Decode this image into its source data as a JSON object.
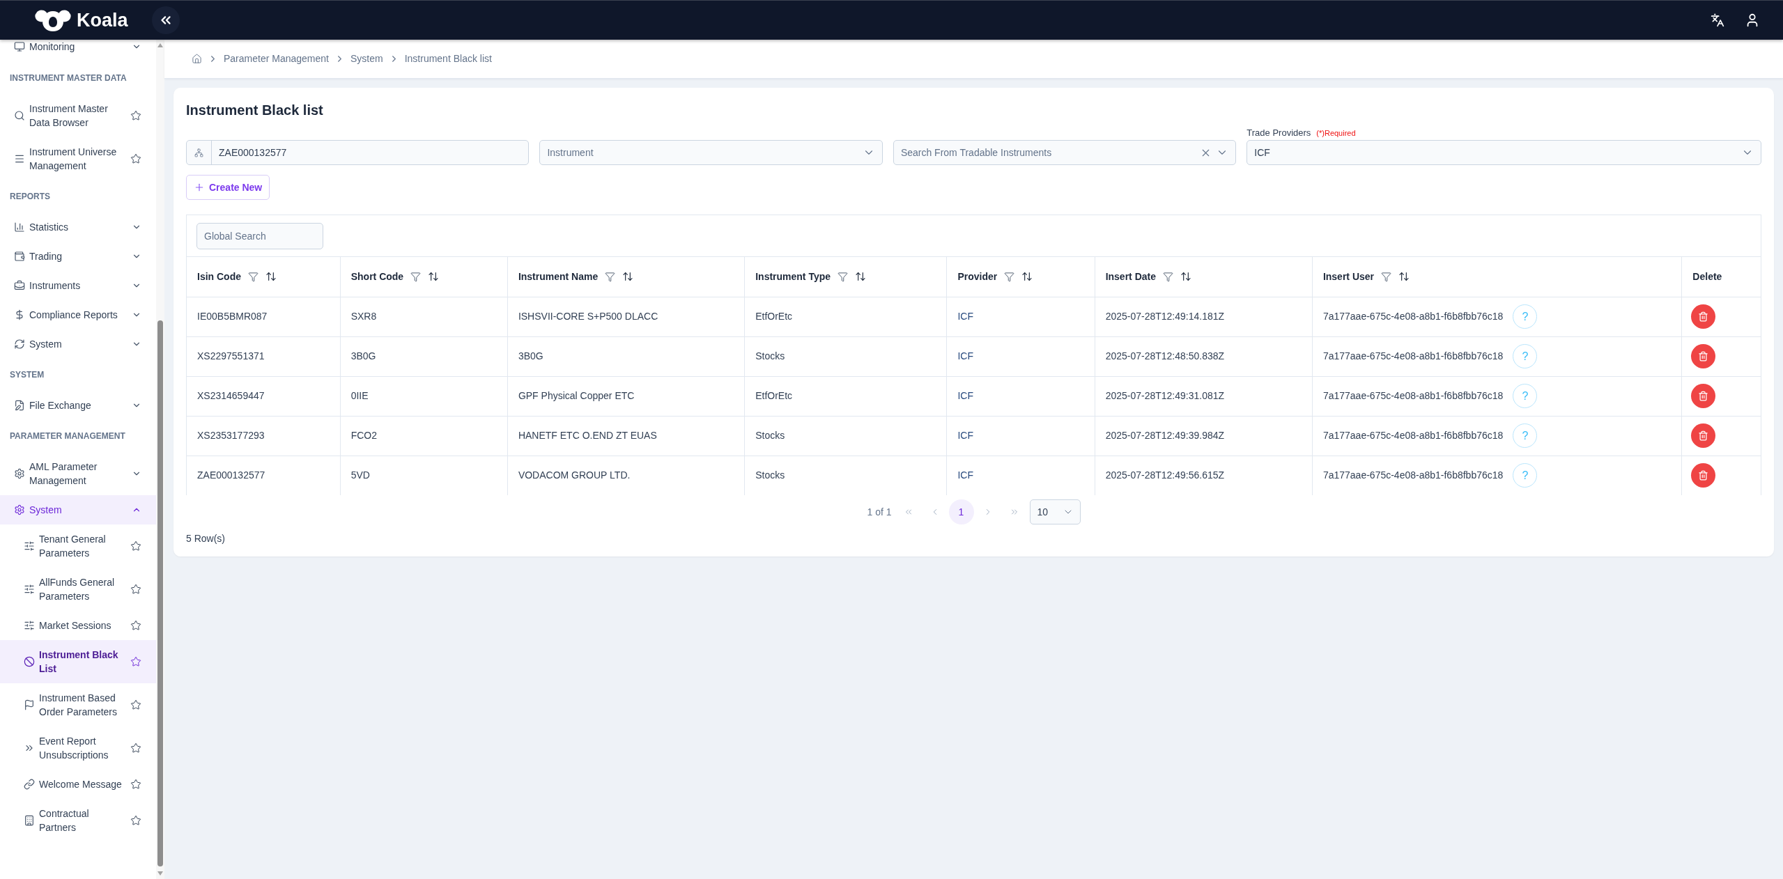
{
  "header": {
    "logo_text": "Koala"
  },
  "sidebar": {
    "sections": [
      {
        "items": [
          {
            "kind": "group",
            "label": "Monitoring",
            "expanded": false
          }
        ]
      },
      {
        "title": "INSTRUMENT MASTER DATA",
        "items": [
          {
            "kind": "link",
            "label": "Instrument Master Data Browser",
            "selected": false
          },
          {
            "kind": "link",
            "label": "Instrument Universe Management",
            "selected": false
          }
        ]
      },
      {
        "title": "REPORTS",
        "items": [
          {
            "kind": "group",
            "label": "Statistics",
            "expanded": false
          },
          {
            "kind": "group",
            "label": "Trading",
            "expanded": false
          },
          {
            "kind": "group",
            "label": "Instruments",
            "expanded": false
          },
          {
            "kind": "group",
            "label": "Compliance Reports",
            "expanded": false
          },
          {
            "kind": "group",
            "label": "System",
            "expanded": false
          }
        ]
      },
      {
        "title": "SYSTEM",
        "items": [
          {
            "kind": "group",
            "label": "File Exchange",
            "expanded": false
          }
        ]
      },
      {
        "title": "PARAMETER MANAGEMENT",
        "items": [
          {
            "kind": "group",
            "label": "AML Parameter Management",
            "expanded": false
          },
          {
            "kind": "group",
            "label": "System",
            "expanded": true,
            "children": [
              {
                "kind": "link",
                "label": "Tenant General Parameters",
                "selected": false
              },
              {
                "kind": "link",
                "label": "AllFunds General Parameters",
                "selected": false
              },
              {
                "kind": "link",
                "label": "Market Sessions",
                "selected": false
              },
              {
                "kind": "link",
                "label": "Instrument Black List",
                "selected": true
              },
              {
                "kind": "link",
                "label": "Instrument Based Order Parameters",
                "selected": false
              },
              {
                "kind": "link",
                "label": "Event Report Unsubscriptions",
                "selected": false
              },
              {
                "kind": "link",
                "label": "Welcome Message",
                "selected": false
              },
              {
                "kind": "link",
                "label": "Contractual Partners",
                "selected": false
              }
            ]
          }
        ]
      }
    ]
  },
  "breadcrumb": [
    "Parameter Management",
    "System",
    "Instrument Black list"
  ],
  "page": {
    "title": "Instrument Black list"
  },
  "filters": [
    {
      "kind": "code",
      "value": "ZAE000132577"
    },
    {
      "kind": "select",
      "placeholder": "Instrument"
    },
    {
      "kind": "search_select",
      "placeholder": "Search From Tradable Instruments"
    },
    {
      "kind": "select",
      "label": "Trade Providers",
      "note": "(*)Required",
      "value": "ICF"
    }
  ],
  "create_button": "Create New",
  "table": {
    "global_search": {
      "placeholder": "Global Search"
    },
    "columns": [
      {
        "label": "Isin Code",
        "kind": "text",
        "filter": true,
        "sort": true
      },
      {
        "label": "Short Code",
        "kind": "text",
        "filter": true,
        "sort": true
      },
      {
        "label": "Instrument Name",
        "kind": "text",
        "filter": true,
        "sort": true
      },
      {
        "label": "Instrument Type",
        "kind": "text",
        "filter": true,
        "sort": true
      },
      {
        "label": "Provider",
        "kind": "link",
        "filter": true,
        "sort": true
      },
      {
        "label": "Insert Date",
        "kind": "text",
        "filter": true,
        "sort": true
      },
      {
        "label": "Insert User",
        "kind": "user",
        "filter": true,
        "sort": true
      },
      {
        "label": "Delete",
        "kind": "action",
        "filter": false,
        "sort": false
      }
    ],
    "rows": [
      {
        "cells": [
          "IE00B5BMR087",
          "SXR8",
          "ISHSVII-CORE S+P500 DLACC",
          "EtfOrEtc",
          "ICF",
          "2025-07-28T12:49:14.181Z",
          "7a177aae-675c-4e08-a8b1-f6b8fbb76c18"
        ],
        "help": "?"
      },
      {
        "cells": [
          "XS2297551371",
          "3B0G",
          "3B0G",
          "Stocks",
          "ICF",
          "2025-07-28T12:48:50.838Z",
          "7a177aae-675c-4e08-a8b1-f6b8fbb76c18"
        ],
        "help": "?"
      },
      {
        "cells": [
          "XS2314659447",
          "0IIE",
          "GPF Physical Copper ETC",
          "EtfOrEtc",
          "ICF",
          "2025-07-28T12:49:31.081Z",
          "7a177aae-675c-4e08-a8b1-f6b8fbb76c18"
        ],
        "help": "?"
      },
      {
        "cells": [
          "XS2353177293",
          "FCO2",
          "HANETF ETC O.END ZT EUAS",
          "Stocks",
          "ICF",
          "2025-07-28T12:49:39.984Z",
          "7a177aae-675c-4e08-a8b1-f6b8fbb76c18"
        ],
        "help": "?"
      },
      {
        "cells": [
          "ZAE000132577",
          "5VD",
          "VODACOM GROUP LTD.",
          "Stocks",
          "ICF",
          "2025-07-28T12:49:56.615Z",
          "7a177aae-675c-4e08-a8b1-f6b8fbb76c18"
        ],
        "help": "?"
      }
    ]
  },
  "pagination": {
    "summary": "1 of 1",
    "pages": [
      {
        "label": "1",
        "selected": true
      }
    ],
    "page_size": "10"
  },
  "row_count": "5 Row(s)"
}
